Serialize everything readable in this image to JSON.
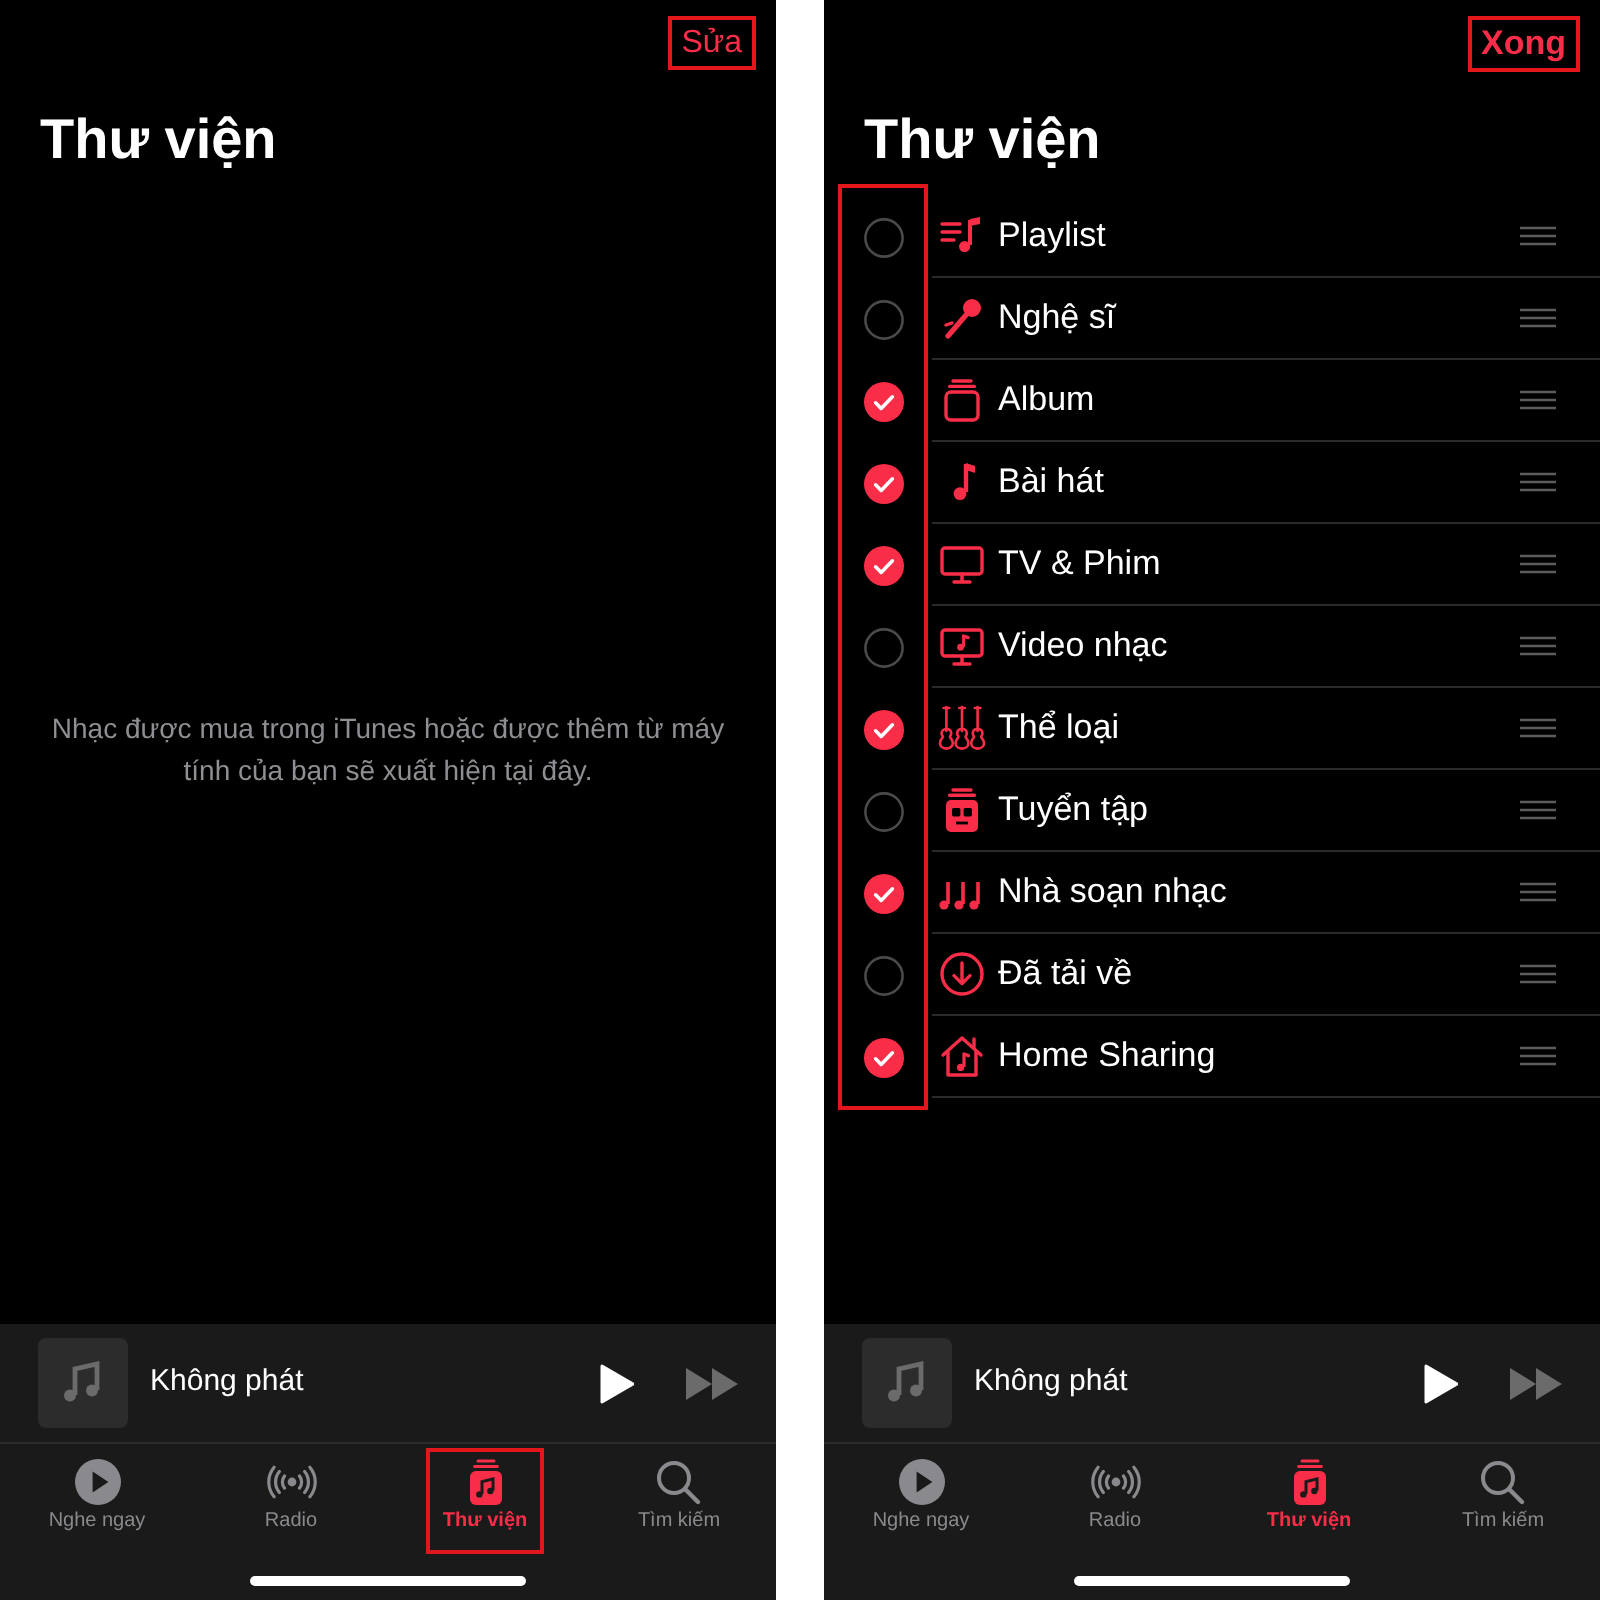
{
  "screens": [
    {
      "nav_button": {
        "kind": "edit",
        "label": "Sửa",
        "highlighted": true
      },
      "title": "Thư viện",
      "empty_message": "Nhạc được mua trong iTunes hoặc được thêm từ máy tính của bạn sẽ xuất hiện tại đây.",
      "mini_player": {
        "title": "Không phát",
        "next_disabled": true
      },
      "tabs": [
        {
          "kind": "listen",
          "label": "Nghe ngay",
          "selected": false,
          "highlighted": false
        },
        {
          "kind": "radio",
          "label": "Radio",
          "selected": false,
          "highlighted": false
        },
        {
          "kind": "library",
          "label": "Thư viện",
          "selected": true,
          "highlighted": true
        },
        {
          "kind": "search",
          "label": "Tìm kiếm",
          "selected": false,
          "highlighted": false
        }
      ]
    },
    {
      "nav_button": {
        "kind": "done",
        "label": "Xong",
        "highlighted": true
      },
      "title": "Thư viện",
      "checks_highlighted": true,
      "items": [
        {
          "kind": "playlists",
          "label": "Playlist",
          "checked": false
        },
        {
          "kind": "artists",
          "label": "Nghệ sĩ",
          "checked": false
        },
        {
          "kind": "albums",
          "label": "Album",
          "checked": true
        },
        {
          "kind": "songs",
          "label": "Bài hát",
          "checked": true
        },
        {
          "kind": "tv",
          "label": "TV & Phim",
          "checked": true
        },
        {
          "kind": "videos",
          "label": "Video nhạc",
          "checked": false
        },
        {
          "kind": "genres",
          "label": "Thể loại",
          "checked": true
        },
        {
          "kind": "compilations",
          "label": "Tuyển tập",
          "checked": false
        },
        {
          "kind": "composers",
          "label": "Nhà soạn nhạc",
          "checked": true
        },
        {
          "kind": "downloaded",
          "label": "Đã tải về",
          "checked": false
        },
        {
          "kind": "sharing",
          "label": "Home Sharing",
          "checked": true
        }
      ],
      "mini_player": {
        "title": "Không phát",
        "next_disabled": true
      },
      "tabs": [
        {
          "kind": "listen",
          "label": "Nghe ngay",
          "selected": false,
          "highlighted": false
        },
        {
          "kind": "radio",
          "label": "Radio",
          "selected": false,
          "highlighted": false
        },
        {
          "kind": "library",
          "label": "Thư viện",
          "selected": true,
          "highlighted": false
        },
        {
          "kind": "search",
          "label": "Tìm kiếm",
          "selected": false,
          "highlighted": false
        }
      ]
    }
  ]
}
